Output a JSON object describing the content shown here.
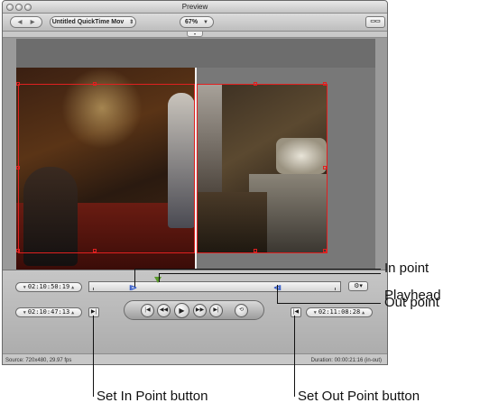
{
  "window": {
    "title": "Preview"
  },
  "toolbar": {
    "document_menu": "Untitled QuickTime Mov",
    "zoom_value": "67%"
  },
  "controls": {
    "in_point_time": "02:10:50:19",
    "set_in_time": "02:10:47:13",
    "set_out_time": "02:11:08:28"
  },
  "status": {
    "source": "Source: 720x480, 29.97 fps",
    "duration": "Duration: 00:00:21:16 (in-out)"
  },
  "callouts": {
    "in_point": "In point",
    "playhead": "Playhead",
    "out_point": "Out point",
    "set_in_button": "Set In Point button",
    "set_out_button": "Set Out Point button"
  }
}
